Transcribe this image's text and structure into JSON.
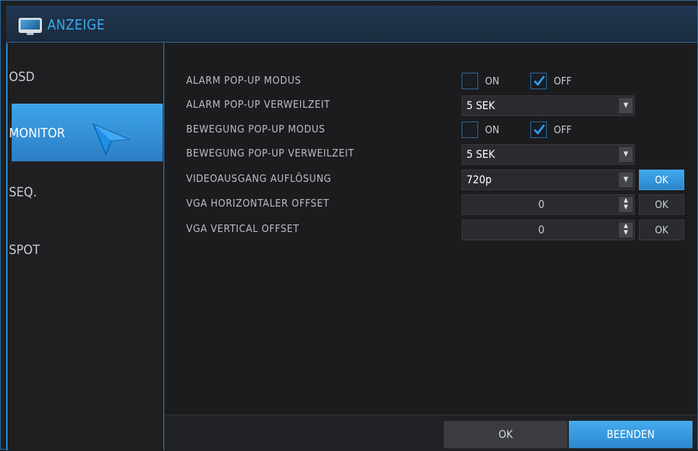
{
  "window": {
    "title": "ANZEIGE",
    "icon": "monitor-icon"
  },
  "sidebar": {
    "items": [
      {
        "label": "OSD",
        "active": false
      },
      {
        "label": "MONITOR",
        "active": true
      },
      {
        "label": "SEQ.",
        "active": false
      },
      {
        "label": "SPOT",
        "active": false
      }
    ]
  },
  "settings": {
    "alarm_popup_mode": {
      "label": "ALARM POP-UP MODUS",
      "on_label": "ON",
      "off_label": "OFF",
      "on_checked": false,
      "off_checked": true
    },
    "alarm_popup_dwell": {
      "label": "ALARM POP-UP VERWEILZEIT",
      "value": "5 SEK"
    },
    "motion_popup_mode": {
      "label": "BEWEGUNG POP-UP MODUS",
      "on_label": "ON",
      "off_label": "OFF",
      "on_checked": false,
      "off_checked": true
    },
    "motion_popup_dwell": {
      "label": "BEWEGUNG POP-UP VERWEILZEIT",
      "value": "5 SEK"
    },
    "video_output_resolution": {
      "label": "VIDEOAUSGANG AUFLÖSUNG",
      "value": "720p",
      "ok_label": "OK"
    },
    "vga_horizontal_offset": {
      "label": "VGA HORIZONTALER OFFSET",
      "value": "0",
      "ok_label": "OK"
    },
    "vga_vertical_offset": {
      "label": "VGA VERTICAL OFFSET",
      "value": "0",
      "ok_label": "OK"
    }
  },
  "footer": {
    "ok_label": "OK",
    "exit_label": "BEENDEN"
  },
  "colors": {
    "accent": "#3fa4ea",
    "border": "#2e6fa3",
    "background": "#1c1c1e"
  }
}
